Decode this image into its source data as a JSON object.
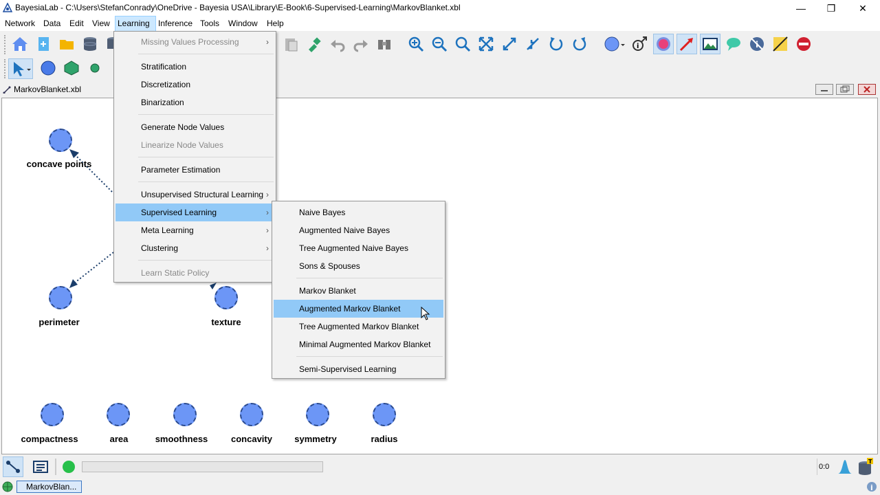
{
  "window": {
    "title": "BayesiaLab - C:\\Users\\StefanConrady\\OneDrive - Bayesia USA\\Library\\E-Book\\6-Supervised-Learning\\MarkovBlanket.xbl"
  },
  "menubar": [
    "Network",
    "Data",
    "Edit",
    "View",
    "Learning",
    "Inference",
    "Tools",
    "Window",
    "Help"
  ],
  "frame": {
    "title": "MarkovBlanket.xbl"
  },
  "nodes": {
    "concave_points": "concave points",
    "perimeter": "perimeter",
    "texture": "texture",
    "compactness": "compactness",
    "area": "area",
    "smoothness": "smoothness",
    "concavity": "concavity",
    "symmetry": "symmetry",
    "radius": "radius"
  },
  "learning_menu": {
    "missing": "Missing Values Processing",
    "stratification": "Stratification",
    "discretization": "Discretization",
    "binarization": "Binarization",
    "generate": "Generate Node Values",
    "linearize": "Linearize Node Values",
    "parameter": "Parameter Estimation",
    "unsupervised": "Unsupervised Structural Learning",
    "supervised": "Supervised Learning",
    "meta": "Meta Learning",
    "clustering": "Clustering",
    "static_policy": "Learn Static Policy"
  },
  "supervised_menu": {
    "naive": "Naive Bayes",
    "aug_naive": "Augmented Naive Bayes",
    "tree_aug_naive": "Tree Augmented Naive Bayes",
    "sons": "Sons & Spouses",
    "markov": "Markov Blanket",
    "aug_markov": "Augmented Markov Blanket",
    "tree_aug_markov": "Tree Augmented Markov Blanket",
    "min_aug_markov": "Minimal Augmented Markov Blanket",
    "semi": "Semi-Supervised Learning"
  },
  "status": {
    "counter": "0:0",
    "task": "MarkovBlan..."
  },
  "colors": {
    "node": "#6c96f6",
    "menu_highlight": "#91c9f7",
    "accent": "#1e73be"
  }
}
